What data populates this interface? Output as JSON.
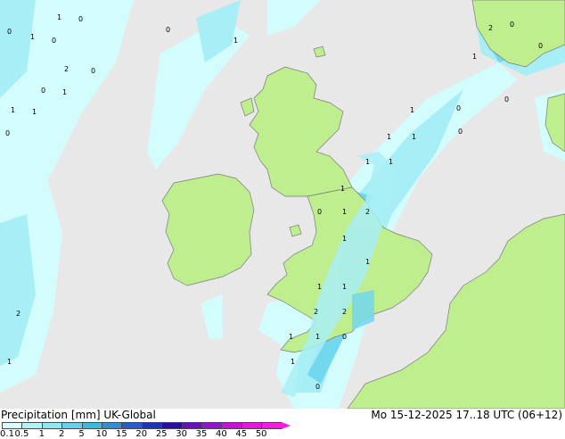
{
  "header": {
    "title": "Precipitation [mm]  UK-Global",
    "timestamp": "Mo 15-12-2025 17..18 UTC (06+12)"
  },
  "legend": {
    "ticks": [
      "0.1",
      "0.5",
      "1",
      "2",
      "5",
      "10",
      "15",
      "20",
      "25",
      "30",
      "35",
      "40",
      "45",
      "50"
    ],
    "colors": [
      "#d7fdfd",
      "#aef4f6",
      "#88eaf2",
      "#60d2ee",
      "#3eb6e6",
      "#2e90d8",
      "#2260c6",
      "#1a36b0",
      "#2a0e9c",
      "#6a10b6",
      "#9a12c6",
      "#c414d0",
      "#e21ad4",
      "#f41ce4"
    ]
  },
  "map": {
    "colors": {
      "sea": "#e8e8e8",
      "land": "#bfee8f",
      "precip_light": "#d3fcfc",
      "precip_mid": "#a8eef6",
      "precip_heavy": "#72d8ee"
    },
    "labels": [
      "1",
      "0",
      "0",
      "1",
      "0",
      "2",
      "0",
      "0",
      "1",
      "0",
      "1",
      "1",
      "0",
      "1",
      "1",
      "0",
      "1",
      "1",
      "0",
      "2",
      "0",
      "0",
      "1",
      "0",
      "1",
      "1",
      "1",
      "1",
      "2",
      "2",
      "1",
      "1",
      "1",
      "1",
      "0",
      "1",
      "0",
      "1",
      "1",
      "2",
      "2",
      "1",
      "0"
    ]
  }
}
